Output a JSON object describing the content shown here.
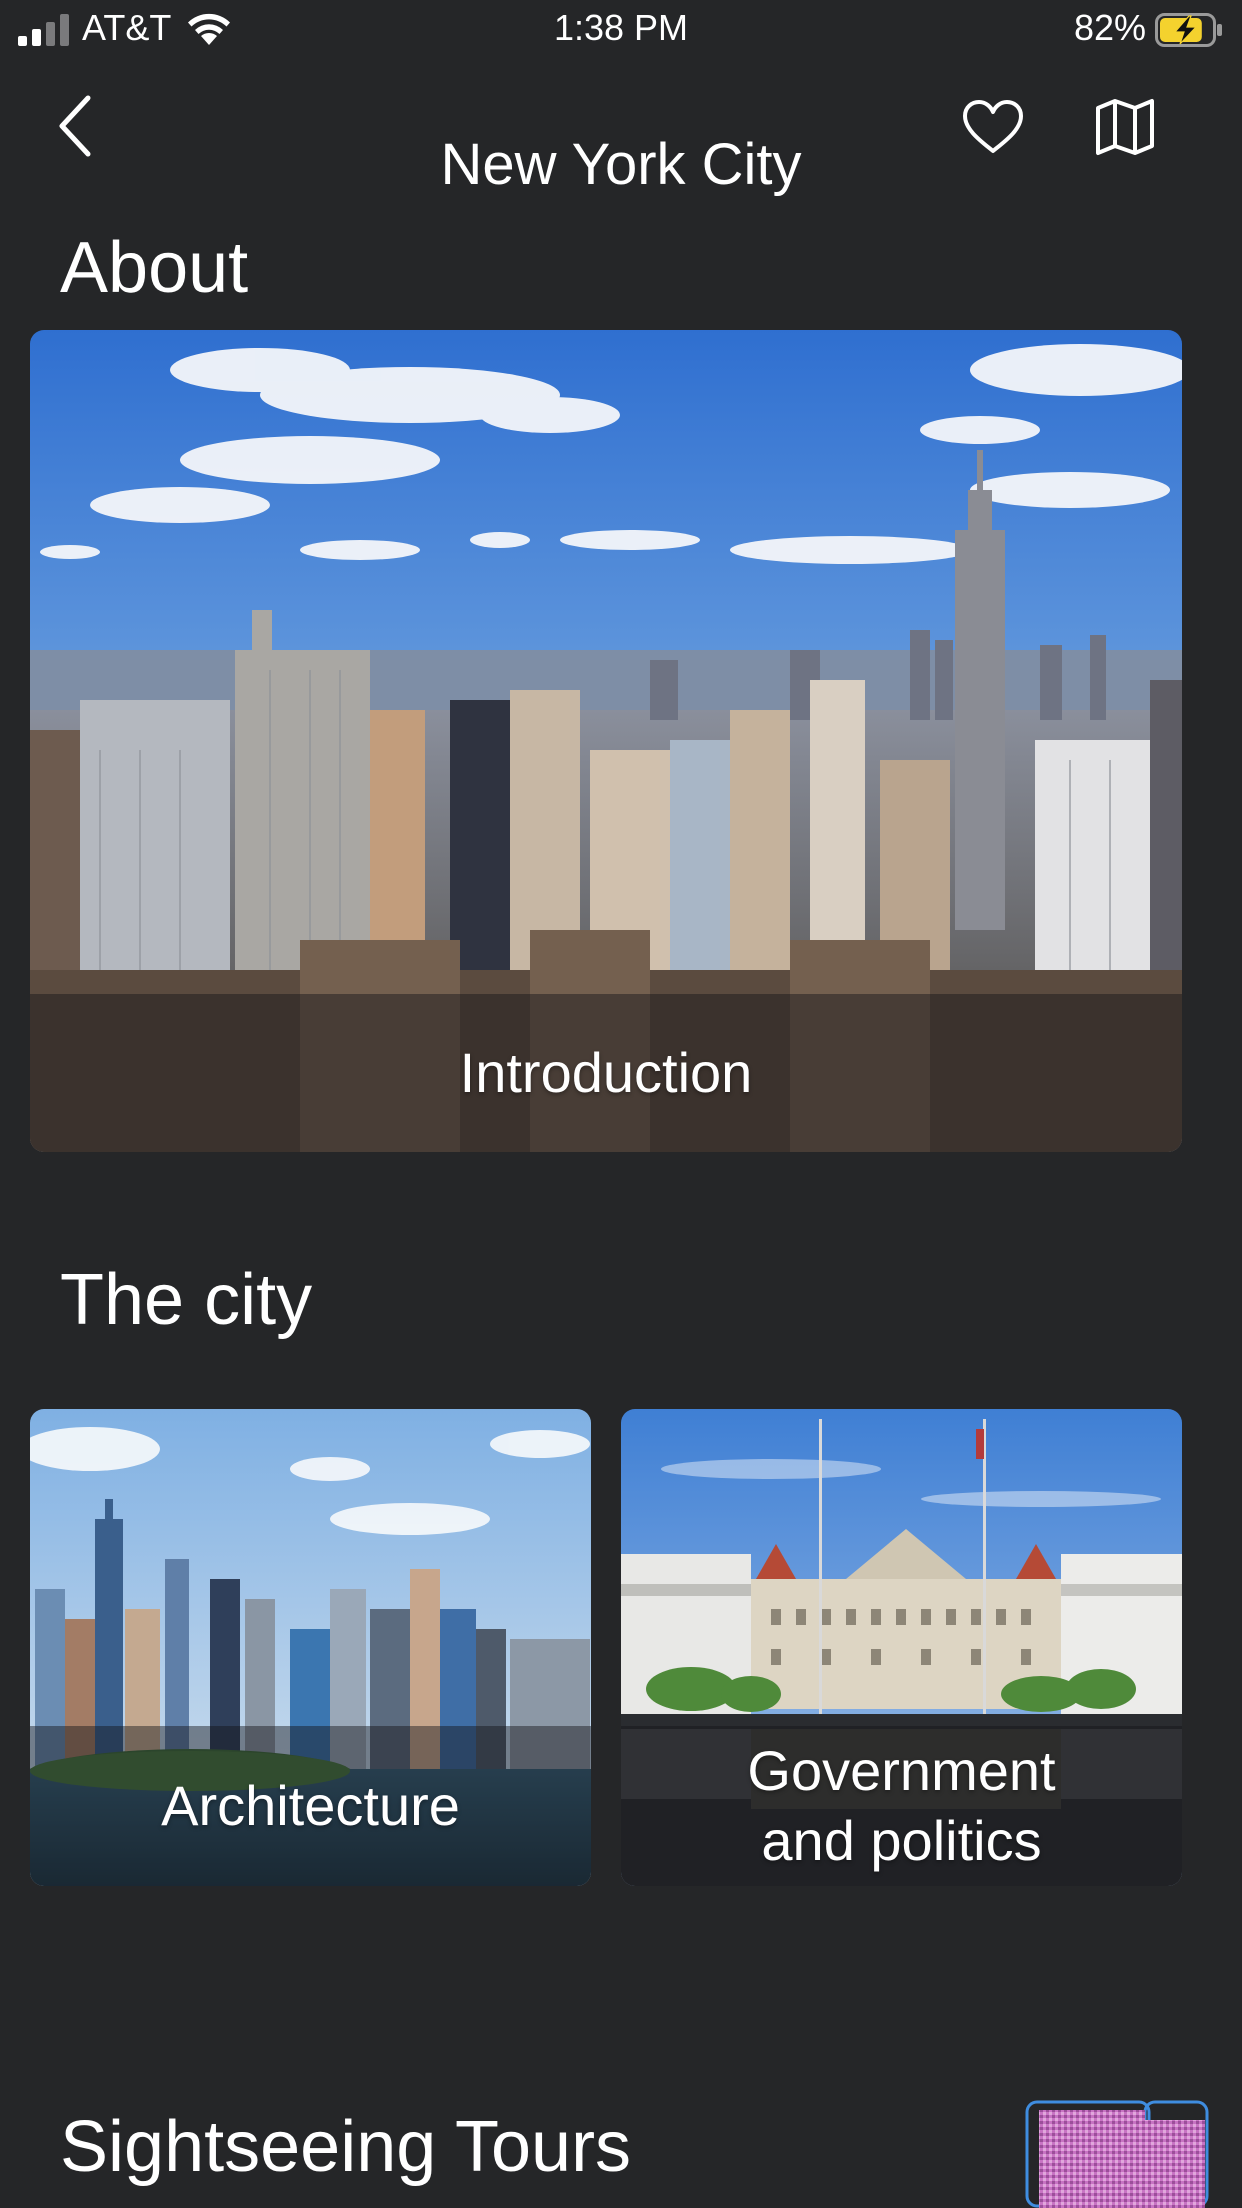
{
  "status_bar": {
    "carrier": "AT&T",
    "time": "1:38 PM",
    "battery_percent": "82%",
    "battery_level": 0.82,
    "charging": true
  },
  "nav": {
    "title": "New York City",
    "back_icon": "chevron-left-icon",
    "favorite_icon": "heart-outline-icon",
    "map_icon": "folded-map-icon"
  },
  "sections": {
    "about": {
      "title": "About",
      "cards": [
        {
          "label": "Introduction",
          "image": "new-york-skyline-aerial"
        }
      ]
    },
    "the_city": {
      "title": "The city",
      "cards": [
        {
          "label": "Architecture",
          "image": "lower-manhattan-waterfront"
        },
        {
          "label_line1": "Government",
          "label_line2": "and politics",
          "image": "state-capitol-building"
        }
      ]
    },
    "tours": {
      "title": "Sightseeing Tours"
    }
  },
  "colors": {
    "background": "#252628",
    "text": "#ffffff",
    "battery_fill": "#f4d22e",
    "badge_outline": "#3f8de0",
    "badge_fill": "#c873c4"
  }
}
